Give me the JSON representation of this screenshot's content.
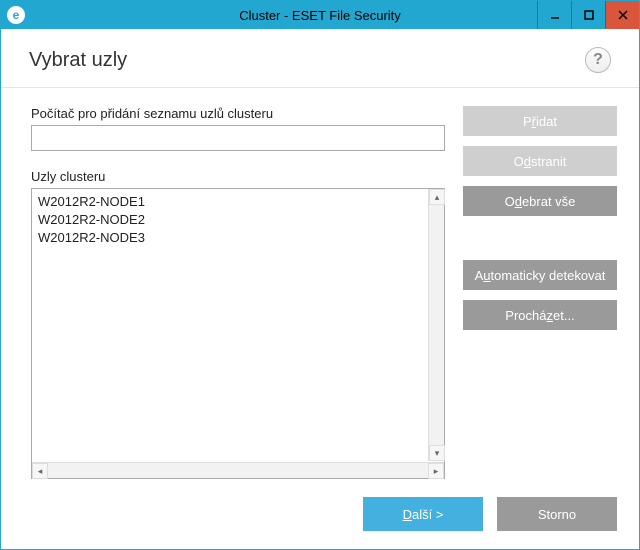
{
  "window": {
    "title": "Cluster - ESET File Security"
  },
  "header": {
    "title": "Vybrat uzly"
  },
  "labels": {
    "add_computer": "Počítač pro přidání seznamu uzlů clusteru",
    "cluster_nodes": "Uzly clusteru"
  },
  "input": {
    "value": ""
  },
  "nodes": [
    "W2012R2-NODE1",
    "W2012R2-NODE2",
    "W2012R2-NODE3"
  ],
  "buttons": {
    "add": {
      "pre": "P",
      "ul": "ř",
      "post": "idat"
    },
    "remove": {
      "pre": "O",
      "ul": "d",
      "post": "stranit"
    },
    "remove_all": {
      "pre": "O",
      "ul": "d",
      "post": "ebrat vše"
    },
    "auto_detect": {
      "pre": "A",
      "ul": "u",
      "post": "tomaticky detekovat"
    },
    "browse": {
      "pre": "Prochá",
      "ul": "z",
      "post": "et..."
    },
    "next": {
      "pre": "",
      "ul": "D",
      "post": "alší >"
    },
    "cancel": "Storno"
  }
}
